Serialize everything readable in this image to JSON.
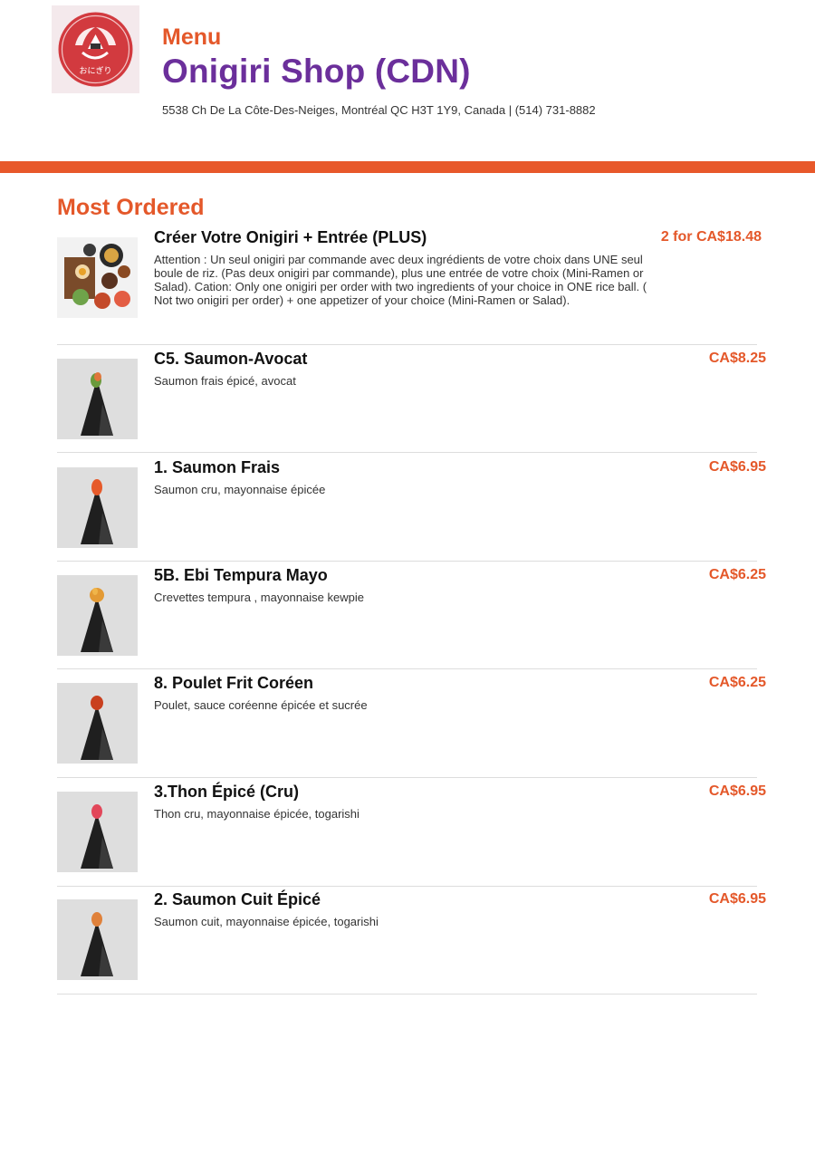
{
  "header": {
    "menu_label": "Menu",
    "shop_name": "Onigiri Shop (CDN)",
    "address": "5538 Ch De La Côte-Des-Neiges, Montréal QC H3T 1Y9, Canada | (514) 731-8882",
    "logo_text": "おにぎり"
  },
  "colors": {
    "accent": "#e4582a",
    "brand": "#6b2f9b",
    "logo_red": "#d23a3f"
  },
  "section": {
    "title": "Most Ordered"
  },
  "items": [
    {
      "name": "Créer Votre Onigiri + Entrée (PLUS)",
      "desc": "Attention : Un seul onigiri par commande avec deux ingrédients de votre choix dans UNE seul boule de riz. (Pas deux onigiri par commande), plus une entrée de votre choix (Mini-Ramen or Salad). Cation: Only one onigiri per order with two ingredients of your choice in ONE rice ball. ( Not two onigiri per order) + one appetizer of your choice (Mini-Ramen or Salad).",
      "price": "2 for CA$18.48",
      "image": "platter-photo"
    },
    {
      "name": "C5. Saumon-Avocat",
      "desc": "Saumon frais épicé, avocat",
      "price": "CA$8.25",
      "image": "onigiri-photo"
    },
    {
      "name": "1. Saumon Frais",
      "desc": "Saumon cru, mayonnaise épicée",
      "price": "CA$6.95",
      "image": "onigiri-photo"
    },
    {
      "name": "5B. Ebi Tempura Mayo",
      "desc": "Crevettes tempura , mayonnaise kewpie",
      "price": "CA$6.25",
      "image": "onigiri-photo"
    },
    {
      "name": "8. Poulet Frit Coréen",
      "desc": "Poulet, sauce coréenne épicée et sucrée",
      "price": "CA$6.25",
      "image": "onigiri-photo"
    },
    {
      "name": "3.Thon Épicé (Cru)",
      "desc": "Thon cru, mayonnaise épicée, togarishi",
      "price": "CA$6.95",
      "image": "onigiri-photo"
    },
    {
      "name": "2. Saumon Cuit Épicé",
      "desc": "Saumon cuit, mayonnaise épicée, togarishi",
      "price": "CA$6.95",
      "image": "onigiri-photo"
    }
  ]
}
